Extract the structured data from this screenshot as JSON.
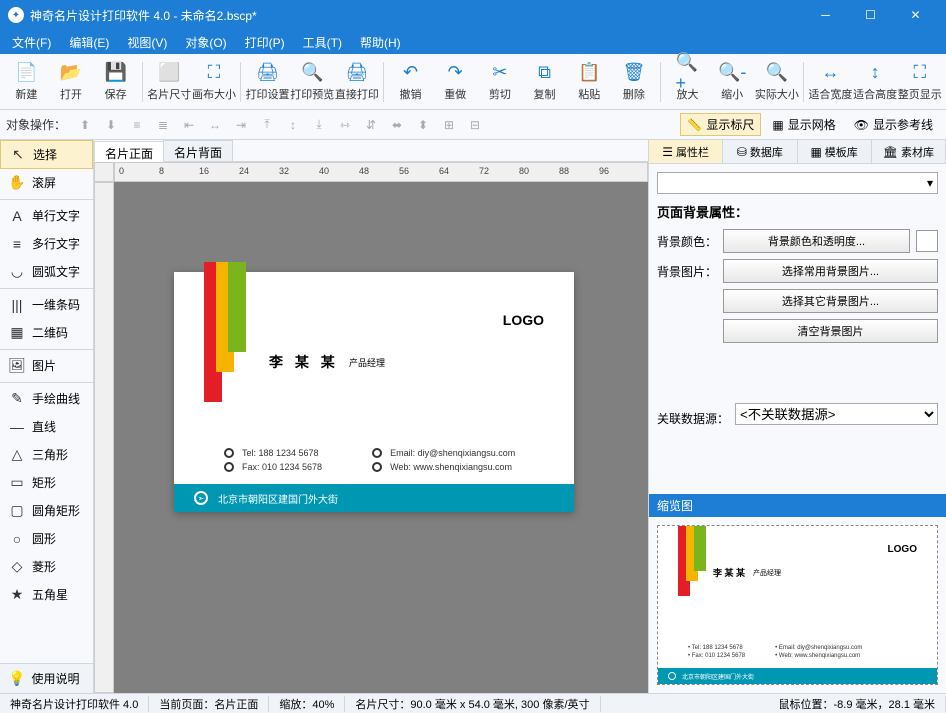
{
  "title": "神奇名片设计打印软件 4.0 - 未命名2.bscp*",
  "menu": [
    "文件(F)",
    "编辑(E)",
    "视图(V)",
    "对象(O)",
    "打印(P)",
    "工具(T)",
    "帮助(H)"
  ],
  "toolbar": [
    {
      "icon": "📄",
      "label": "新建"
    },
    {
      "icon": "📂",
      "label": "打开"
    },
    {
      "icon": "💾",
      "label": "保存"
    },
    {
      "sep": true
    },
    {
      "icon": "⬜",
      "label": "名片尺寸"
    },
    {
      "icon": "⛶",
      "label": "画布大小"
    },
    {
      "sep": true
    },
    {
      "icon": "🖨",
      "label": "打印设置"
    },
    {
      "icon": "🔍",
      "label": "打印预览"
    },
    {
      "icon": "🖨",
      "label": "直接打印"
    },
    {
      "sep": true
    },
    {
      "icon": "↶",
      "label": "撤销"
    },
    {
      "icon": "↷",
      "label": "重做"
    },
    {
      "icon": "✂",
      "label": "剪切"
    },
    {
      "icon": "⧉",
      "label": "复制"
    },
    {
      "icon": "📋",
      "label": "粘贴"
    },
    {
      "icon": "🗑",
      "label": "删除"
    },
    {
      "sep": true
    },
    {
      "icon": "🔍+",
      "label": "放大"
    },
    {
      "icon": "🔍-",
      "label": "缩小"
    },
    {
      "icon": "🔍",
      "label": "实际大小"
    },
    {
      "sep": true
    },
    {
      "icon": "↔",
      "label": "适合宽度"
    },
    {
      "icon": "↕",
      "label": "适合高度"
    },
    {
      "icon": "⛶",
      "label": "整页显示"
    }
  ],
  "toolbar2": {
    "label": "对象操作：",
    "toggles": [
      {
        "label": "显示标尺",
        "active": true
      },
      {
        "label": "显示网格",
        "active": false
      },
      {
        "label": "显示参考线",
        "active": false
      }
    ]
  },
  "lefttools": [
    {
      "icon": "↖",
      "label": "选择",
      "sel": true
    },
    {
      "icon": "✋",
      "label": "滚屏"
    },
    {
      "sep": true
    },
    {
      "icon": "A",
      "label": "单行文字"
    },
    {
      "icon": "≡",
      "label": "多行文字"
    },
    {
      "icon": "◡",
      "label": "圆弧文字"
    },
    {
      "sep": true
    },
    {
      "icon": "|||",
      "label": "一维条码"
    },
    {
      "icon": "▦",
      "label": "二维码"
    },
    {
      "sep": true
    },
    {
      "icon": "🖼",
      "label": "图片"
    },
    {
      "sep": true
    },
    {
      "icon": "✎",
      "label": "手绘曲线"
    },
    {
      "icon": "—",
      "label": "直线"
    },
    {
      "icon": "△",
      "label": "三角形"
    },
    {
      "icon": "▭",
      "label": "矩形"
    },
    {
      "icon": "▢",
      "label": "圆角矩形"
    },
    {
      "icon": "○",
      "label": "圆形"
    },
    {
      "icon": "◇",
      "label": "菱形"
    },
    {
      "icon": "★",
      "label": "五角星"
    }
  ],
  "help_label": "使用说明",
  "tabs": [
    {
      "label": "名片正面",
      "active": true
    },
    {
      "label": "名片背面",
      "active": false
    }
  ],
  "ruler_marks": [
    "0",
    "8",
    "16",
    "24",
    "32",
    "40",
    "48",
    "56",
    "64",
    "72",
    "80",
    "88",
    "96"
  ],
  "card": {
    "logo": "LOGO",
    "name": "李 某 某",
    "role": "产品经理",
    "contacts": [
      {
        "k": "Tel:",
        "v": "188 1234 5678"
      },
      {
        "k": "Email:",
        "v": "diy@shenqixiangsu.com"
      },
      {
        "k": "Fax:",
        "v": "010 1234 5678"
      },
      {
        "k": "Web:",
        "v": "www.shenqixiangsu.com"
      }
    ],
    "address": "北京市朝阳区建国门外大街"
  },
  "rtabs": [
    {
      "icon": "☰",
      "label": "属性栏",
      "active": true
    },
    {
      "icon": "⛁",
      "label": "数据库"
    },
    {
      "icon": "▦",
      "label": "模板库"
    },
    {
      "icon": "🏛",
      "label": "素材库"
    }
  ],
  "props": {
    "section": "页面背景属性：",
    "bgcolor_label": "背景颜色：",
    "bgcolor_btn": "背景颜色和透明度...",
    "bgimg_label": "背景图片：",
    "bgimg_btn1": "选择常用背景图片...",
    "bgimg_btn2": "选择其它背景图片...",
    "bgimg_btn3": "清空背景图片",
    "ds_label": "关联数据源：",
    "ds_value": "<不关联数据源>"
  },
  "thumb_title": "缩览图",
  "status": {
    "app": "神奇名片设计打印软件 4.0",
    "page": "当前页面：名片正面",
    "zoom": "缩放：40%",
    "size": "名片尺寸：90.0 毫米 x 54.0 毫米, 300 像素/英寸",
    "mouse": "鼠标位置：-8.9 毫米，28.1 毫米"
  }
}
